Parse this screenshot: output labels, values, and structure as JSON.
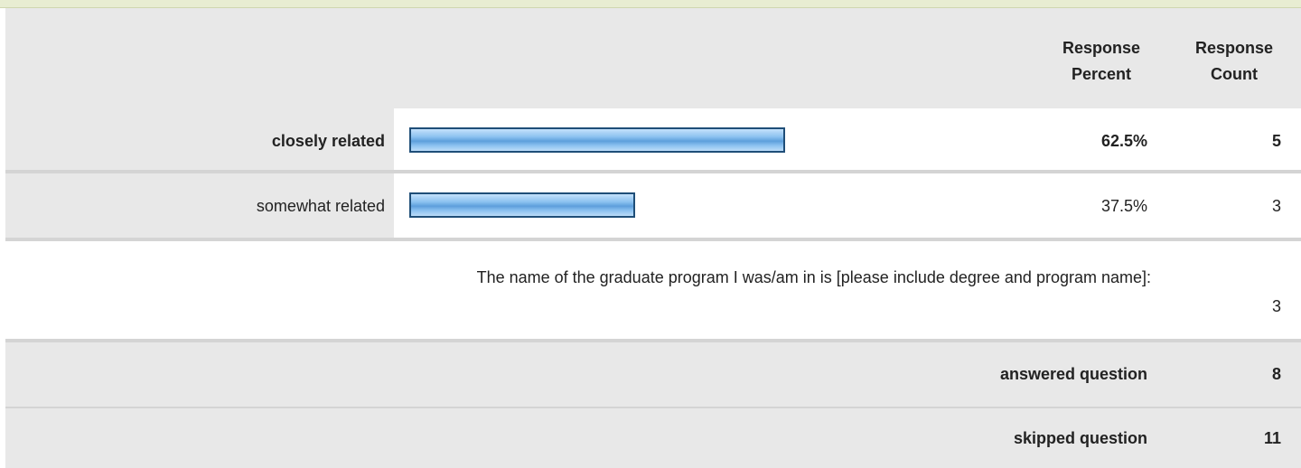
{
  "header": {
    "response_percent": "Response Percent",
    "response_count": "Response Count"
  },
  "rows": [
    {
      "label": "closely related",
      "percent": "62.5%",
      "count": "5",
      "fraction": 0.625,
      "bold": true
    },
    {
      "label": "somewhat related",
      "percent": "37.5%",
      "count": "3",
      "fraction": 0.375,
      "bold": false
    }
  ],
  "other": {
    "text": "The name of the graduate program I was/am in is [please include degree and program name]:",
    "count": "3"
  },
  "summary": {
    "answered_label": "answered question",
    "answered_count": "8",
    "skipped_label": "skipped question",
    "skipped_count": "11"
  },
  "colors": {
    "header_bg": "#e8e8e8",
    "top_strip": "#e8edd2",
    "bar_border": "#1f4e78",
    "bar_fill": "#8cc2f0"
  }
}
